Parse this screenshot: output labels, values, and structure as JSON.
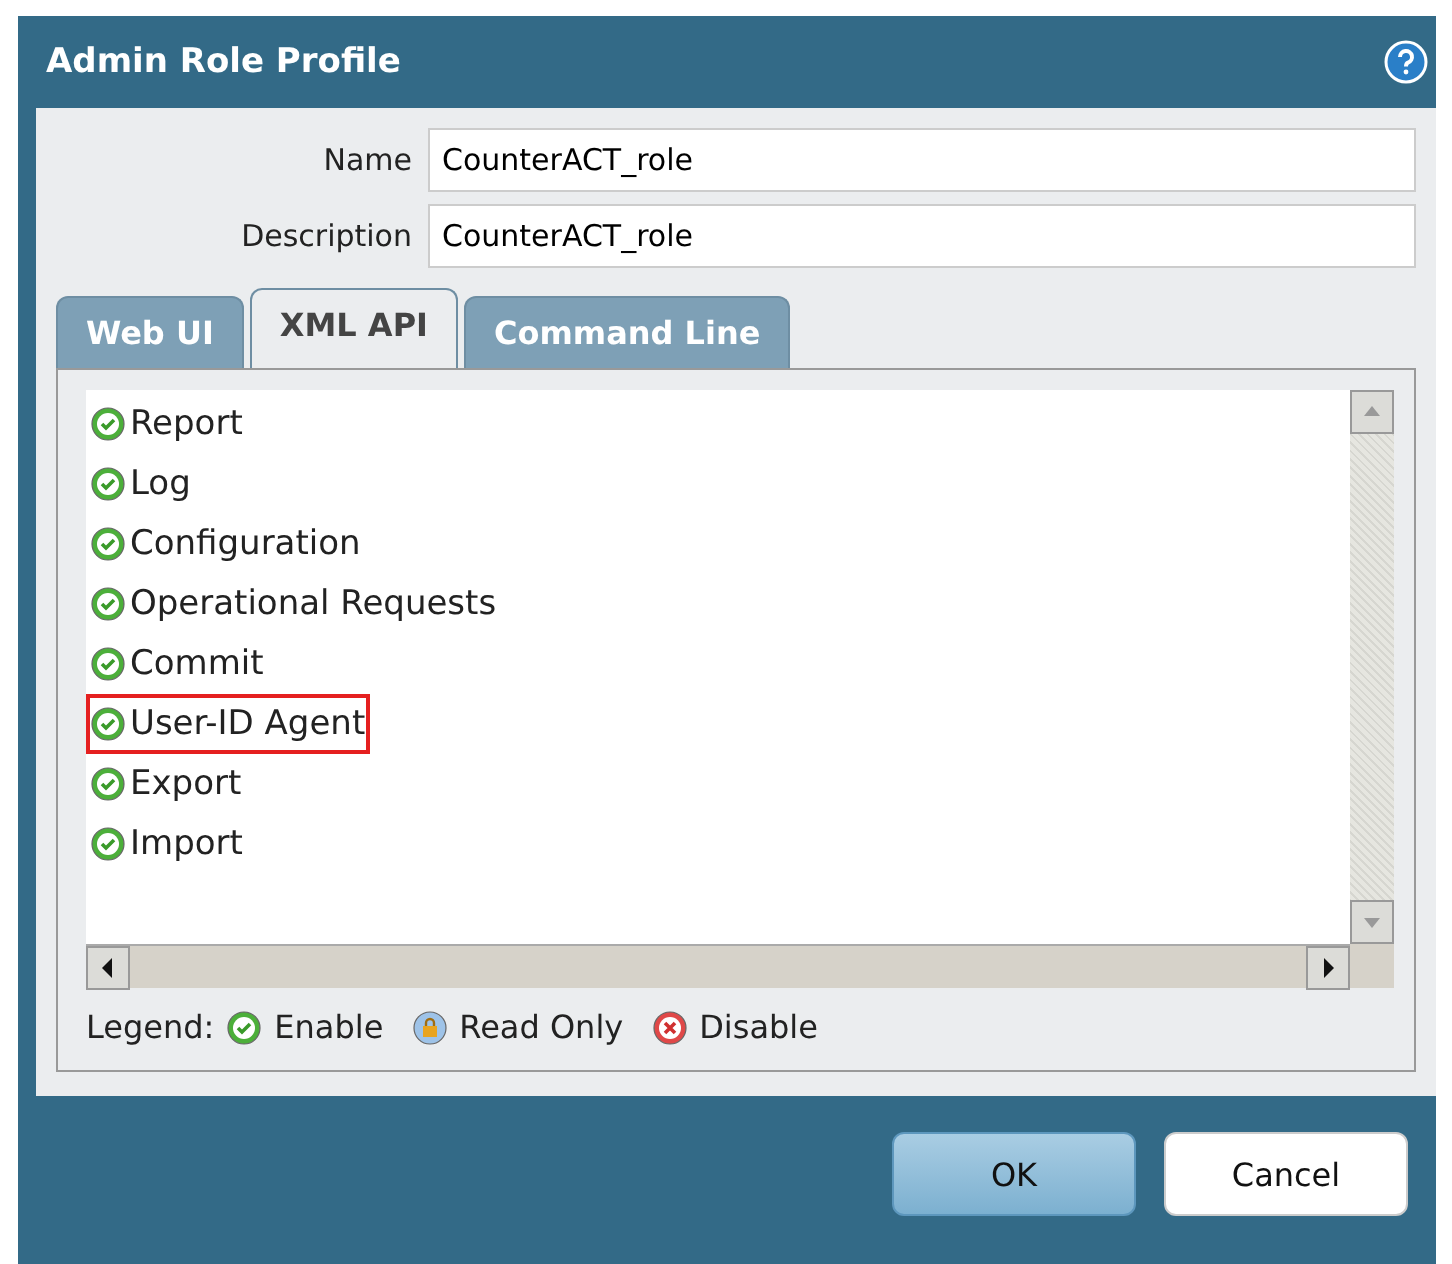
{
  "window": {
    "title": "Admin Role Profile"
  },
  "fields": [
    {
      "label": "Name",
      "value": "CounterACT_role"
    },
    {
      "label": "Description",
      "value": "CounterACT_role"
    }
  ],
  "tabs": [
    {
      "label": "Web UI",
      "selected": false
    },
    {
      "label": "XML API",
      "selected": true
    },
    {
      "label": "Command Line",
      "selected": false
    }
  ],
  "permissions": [
    {
      "label": "Report",
      "kind": "enable",
      "highlighted": false
    },
    {
      "label": "Log",
      "kind": "enable",
      "highlighted": false
    },
    {
      "label": "Configuration",
      "kind": "enable",
      "highlighted": false
    },
    {
      "label": "Operational Requests",
      "kind": "enable",
      "highlighted": false
    },
    {
      "label": "Commit",
      "kind": "enable",
      "highlighted": false
    },
    {
      "label": "User-ID Agent",
      "kind": "enable",
      "highlighted": true
    },
    {
      "label": "Export",
      "kind": "enable",
      "highlighted": false
    },
    {
      "label": "Import",
      "kind": "enable",
      "highlighted": false
    }
  ],
  "legend": {
    "label": "Legend:",
    "items": [
      {
        "kind": "enable",
        "label": "Enable"
      },
      {
        "kind": "readonly",
        "label": "Read Only"
      },
      {
        "kind": "disable",
        "label": "Disable"
      }
    ]
  },
  "buttons": [
    {
      "label": "OK",
      "kind": "primary"
    },
    {
      "label": "Cancel",
      "kind": "secondary"
    }
  ]
}
